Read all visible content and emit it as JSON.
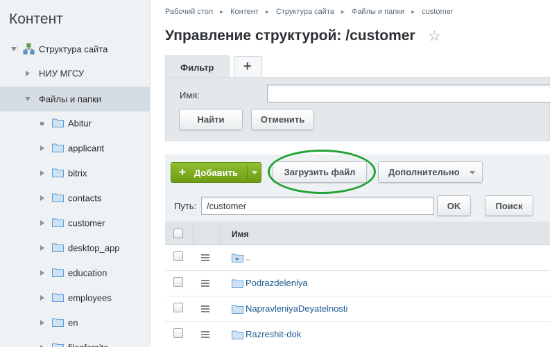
{
  "sidebar": {
    "title": "Контент",
    "items": [
      {
        "label": "Структура сайта"
      },
      {
        "label": "НИУ МГСУ"
      },
      {
        "label": "Файлы и папки"
      },
      {
        "label": "Abitur"
      },
      {
        "label": "applicant"
      },
      {
        "label": "bitrix"
      },
      {
        "label": "contacts"
      },
      {
        "label": "customer"
      },
      {
        "label": "desktop_app"
      },
      {
        "label": "education"
      },
      {
        "label": "employees"
      },
      {
        "label": "en"
      },
      {
        "label": "filesforsite"
      }
    ]
  },
  "breadcrumb": [
    "Рабочий стол",
    "Контент",
    "Структура сайта",
    "Файлы и папки",
    "customer"
  ],
  "page_title": "Управление структурой: /customer",
  "filter": {
    "tab_label": "Фильтр",
    "add_tab": "+",
    "name_label": "Имя:",
    "name_value": "",
    "find_label": "Найти",
    "cancel_label": "Отменить"
  },
  "toolbar": {
    "add_label": "Добавить",
    "add_icon": "+",
    "upload_label": "Загрузить файл",
    "more_label": "Дополнительно",
    "path_label": "Путь:",
    "path_value": "/customer",
    "ok_label": "OK",
    "search_label": "Поиск"
  },
  "table": {
    "header_name": "Имя",
    "rows": [
      {
        "name": ".."
      },
      {
        "name": "Podrazdeleniya"
      },
      {
        "name": "NapravleniyaDeyatelnosti"
      },
      {
        "name": "Razreshit-dok"
      }
    ]
  },
  "colors": {
    "accent_green": "#7bab1e",
    "highlight_oval": "#22a335",
    "folder": "#5b9bd5"
  }
}
